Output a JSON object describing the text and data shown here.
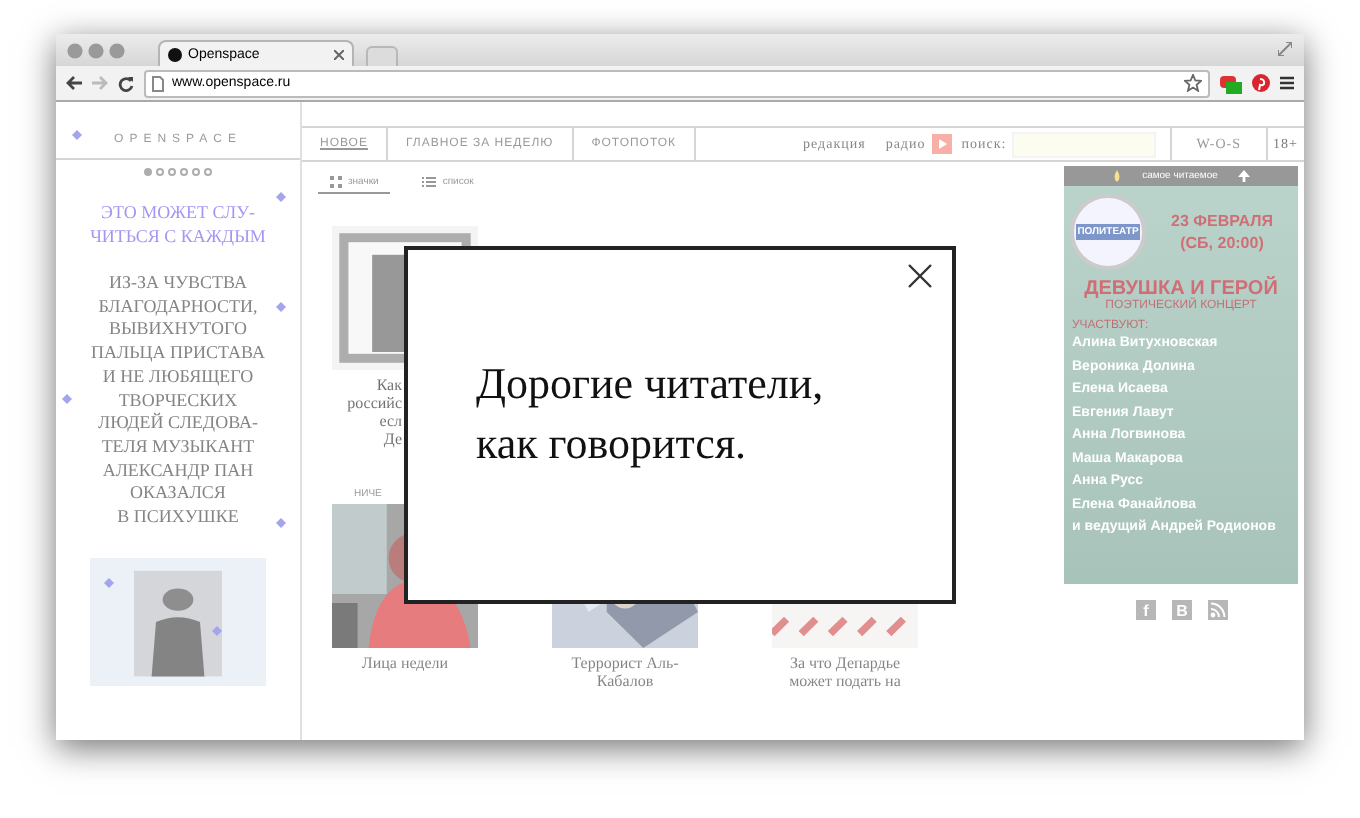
{
  "browser": {
    "tab_title": "Openspace",
    "url": "www.openspace.ru"
  },
  "site": {
    "logo": "OPENSPACE",
    "slider_dots": [
      {
        "selected": true
      },
      {
        "selected": false
      },
      {
        "selected": false
      },
      {
        "selected": false
      },
      {
        "selected": false
      },
      {
        "selected": false
      }
    ],
    "nav_tabs": [
      {
        "label": "НОВОЕ",
        "selected": true
      },
      {
        "label": "ГЛАВНОЕ ЗА НЕДЕЛЮ",
        "selected": false
      },
      {
        "label": "ФОТОПОТОК",
        "selected": false
      }
    ],
    "nav_links": [
      "редакция",
      "радио"
    ],
    "search_label": "поиск:",
    "wos": "W-O-S",
    "age": "18+",
    "view_modes": [
      {
        "label": "значки",
        "selected": true
      },
      {
        "label": "список",
        "selected": false
      }
    ],
    "promo": {
      "headline": "ЭТО МОЖЕТ СЛУ-\nЧИТЬСЯ С КАЖДЫМ",
      "text": "ИЗ-ЗА ЧУВСТВА\nБЛАГОДАРНОСТИ,\nВЫВИХНУТОГО\nПАЛЬЦА ПРИСТАВА\nИ НЕ ЛЮБЯЩЕГО\nТВОРЧЕСКИХ\nЛЮДЕЙ СЛЕДОВА-\nТЕЛЯ МУЗЫКАНТ\nАЛЕКСАНДР ПАН\nОКАЗАЛСЯ\nВ ПСИХУШКЕ"
    },
    "top_card": {
      "caption": "Как\nроссийс\nесл\nДе"
    },
    "section_label": "НИЧЕ",
    "cards": [
      {
        "caption": "Лица недели",
        "kind": "portrait"
      },
      {
        "caption": "Террорист Аль-\nКабалов",
        "kind": "hands"
      },
      {
        "caption": "За что Депардье\nможет подать на",
        "kind": "emblem"
      }
    ],
    "banner": {
      "title": "самое читаемое",
      "logo": "ПОЛИТЕАТР",
      "date": "23 ФЕВРАЛЯ",
      "time": "(СБ, 20:00)",
      "event": "ДЕВУШКА И ГЕРОЙ",
      "subtitle": "ПОЭТИЧЕСКИЙ КОНЦЕРТ",
      "participants_label": "УЧАСТВУЮТ:",
      "participants": [
        "Алина Витухновская",
        "Вероника Долина",
        "Елена Исаева",
        "Евгения Лавут",
        "Анна Логвинова",
        "Маша Макарова",
        "Анна Русс",
        "Елена Фанайлова",
        "и ведущий Андрей Родионов"
      ]
    },
    "social": [
      "f",
      "В"
    ]
  },
  "modal": {
    "text": "Дорогие читатели, как говорится."
  }
}
